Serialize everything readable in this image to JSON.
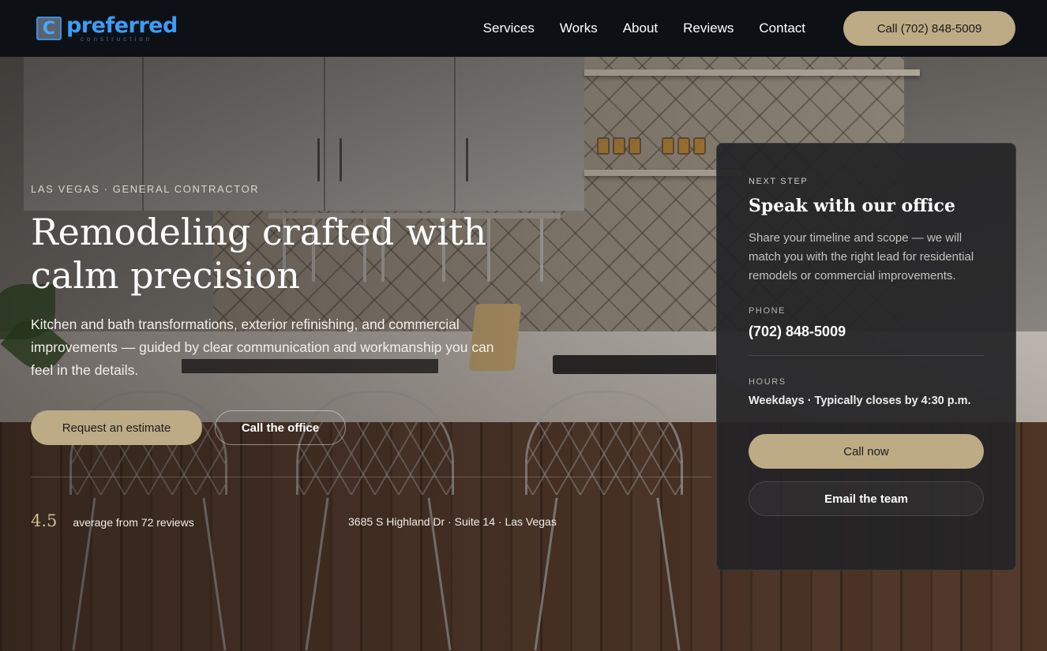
{
  "theme": {
    "accent": "#bdab85",
    "header_bg": "#0d1116",
    "logo_blue": "#3d9cf5",
    "card_bg": "#242426"
  },
  "header": {
    "logo": {
      "icon": "preferred-construction-logo-icon",
      "name": "preferred",
      "subtitle": "construction"
    },
    "nav": [
      "Services",
      "Works",
      "About",
      "Reviews",
      "Contact"
    ],
    "call_button": "Call (702) 848-5009"
  },
  "hero": {
    "eyebrow": "LAS VEGAS · GENERAL CONTRACTOR",
    "title": "Remodeling crafted with calm precision",
    "description": "Kitchen and bath transformations, exterior refinishing, and commercial improvements — guided by clear communication and workmanship you can feel in the details.",
    "primary_button": "Request an estimate",
    "secondary_button": "Call the office",
    "rating": {
      "value": "4.5",
      "text": "average from 72 reviews"
    },
    "address": "3685 S Highland Dr · Suite 14 · Las Vegas"
  },
  "card": {
    "eyebrow": "NEXT STEP",
    "title": "Speak with our office",
    "description": "Share your timeline and scope — we will match you with the right lead for residential remodels or commercial improvements.",
    "phone_label": "PHONE",
    "phone": "(702) 848-5009",
    "hours_label": "HOURS",
    "hours": "Weekdays · Typically closes by 4:30 p.m.",
    "call_button": "Call now",
    "email_button": "Email the team"
  }
}
